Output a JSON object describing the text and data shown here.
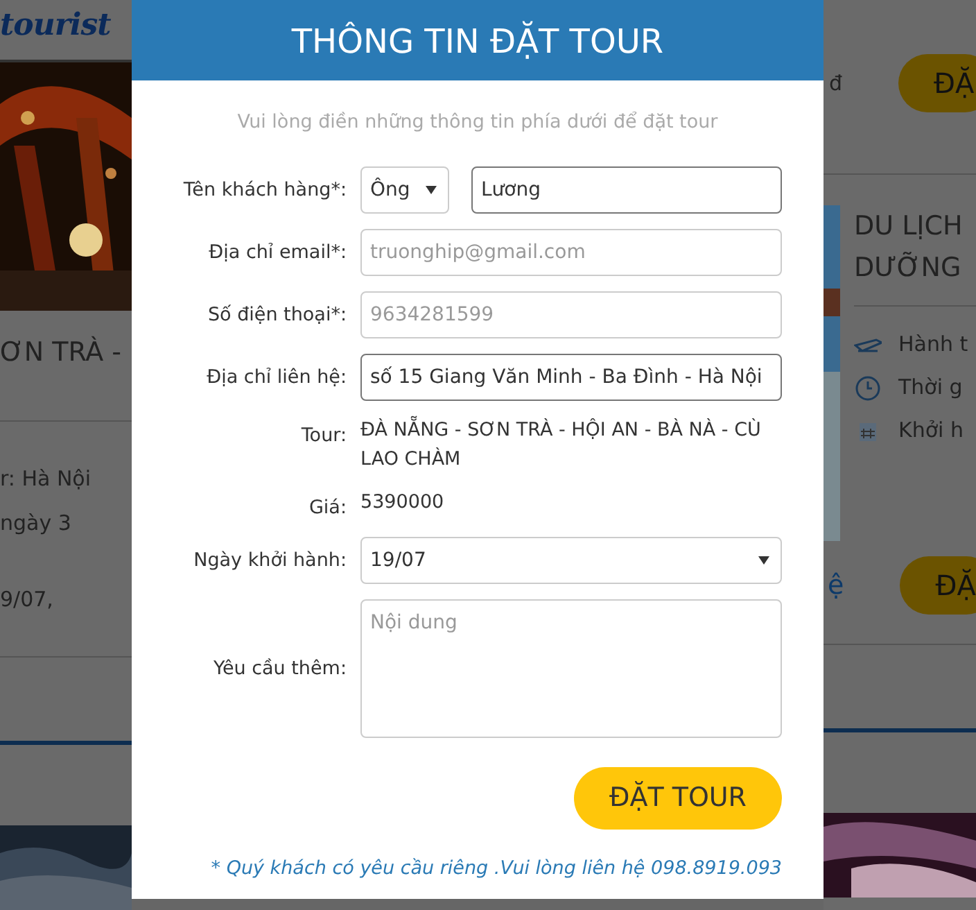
{
  "background": {
    "logo": "tourist",
    "left": {
      "title": "ƠN TRÀ -",
      "details": [
        "r: Hà Nội",
        "ngày 3",
        "9/07,"
      ]
    },
    "right": {
      "price": "đ",
      "book_button": "ĐẶ",
      "title_lines": [
        "DU LỊCH",
        "DƯỠNG"
      ],
      "details": [
        {
          "kind": "plane",
          "text": "Hành t"
        },
        {
          "kind": "clock",
          "text": "Thời g"
        },
        {
          "kind": "calendar",
          "text": "Khởi h"
        }
      ],
      "link": "ệ",
      "book_button_2": "ĐẶ"
    }
  },
  "modal": {
    "title": "THÔNG TIN ĐẶT TOUR",
    "subtitle": "Vui lòng điền những thông tin phía dưới để đặt tour",
    "fields": [
      {
        "kind": "name",
        "label": "Tên khách hàng*:",
        "select": "Ông",
        "value": "Lương"
      },
      {
        "kind": "input",
        "label": "Địa chỉ email*:",
        "placeholder": "truonghip@gmail.com"
      },
      {
        "kind": "input",
        "label": "Số điện thoại*:",
        "placeholder": "9634281599"
      },
      {
        "kind": "input",
        "label": "Địa chỉ liên hệ:",
        "value": "số 15 Giang Văn Minh - Ba Đình - Hà Nội"
      },
      {
        "kind": "text",
        "label": "Tour:",
        "text": "ĐÀ NẴNG - SƠN TRÀ - HỘI AN - BÀ NÀ - CÙ LAO CHÀM"
      },
      {
        "kind": "text",
        "label": "Giá:",
        "text": "5390000"
      },
      {
        "kind": "select",
        "label": "Ngày khởi hành:",
        "value": "19/07"
      },
      {
        "kind": "textarea",
        "label": "Yêu cầu thêm:",
        "placeholder": "Nội dung"
      }
    ],
    "submit": "ĐẶT TOUR",
    "note": "* Quý khách có yêu cầu riêng .Vui lòng liên hệ 098.8919.093"
  }
}
